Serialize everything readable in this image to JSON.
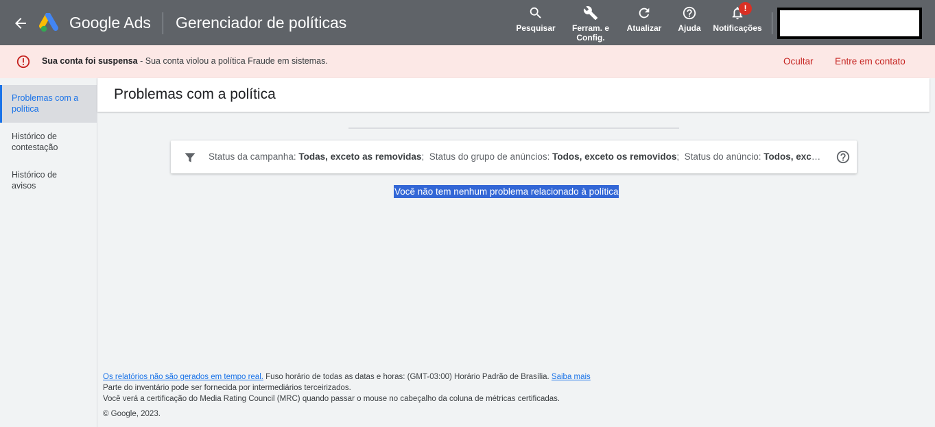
{
  "header": {
    "brand": "Google Ads",
    "page_title": "Gerenciador de políticas",
    "tools": [
      {
        "label": "Pesquisar",
        "icon": "search-icon"
      },
      {
        "label_line1": "Ferram. e",
        "label_line2": "Config.",
        "icon": "wrench-icon"
      },
      {
        "label": "Atualizar",
        "icon": "refresh-icon"
      },
      {
        "label": "Ajuda",
        "icon": "help-icon"
      },
      {
        "label": "Notificações",
        "icon": "bell-icon",
        "badge": "!"
      }
    ]
  },
  "banner": {
    "bold": "Sua conta foi suspensa",
    "text": " - Sua conta violou a política Fraude em sistemas.",
    "hide": "Ocultar",
    "contact": "Entre em contato"
  },
  "sidebar": {
    "items": [
      {
        "line1": "Problemas com a",
        "line2": "política"
      },
      {
        "line1": "Histórico de",
        "line2": "contestação"
      },
      {
        "line1": "Histórico de",
        "line2": "avisos"
      }
    ]
  },
  "main": {
    "title": "Problemas com a política",
    "filter": {
      "campaign_label": "Status da campanha: ",
      "campaign_value": "Todas, exceto as removidas",
      "adgroup_label": "Status do grupo de anúncios: ",
      "adgroup_value": "Todos, exceto os removidos",
      "ad_label": "Status do anúncio: ",
      "ad_value": "Todos, exceto os removidos"
    },
    "empty_message": "Você não tem nenhum problema relacionado à política"
  },
  "footer": {
    "link1": "Os relatórios não são gerados em tempo real.",
    "timezone": " Fuso horário de todas as datas e horas: (GMT-03:00) Horário Padrão de Brasília. ",
    "link2": "Saiba mais",
    "line2": "Parte do inventário pode ser fornecida por intermediários terceirizados.",
    "line3": "Você verá a certificação do Media Rating Council (MRC) quando passar o mouse no cabeçalho da coluna de métricas certificadas.",
    "copyright": "© Google, 2023."
  },
  "colors": {
    "header_bg": "#5f6368",
    "banner_bg": "#fce8e6",
    "error_red": "#c5221f",
    "link_blue": "#1a73e8",
    "selection_blue": "#3367d6"
  }
}
